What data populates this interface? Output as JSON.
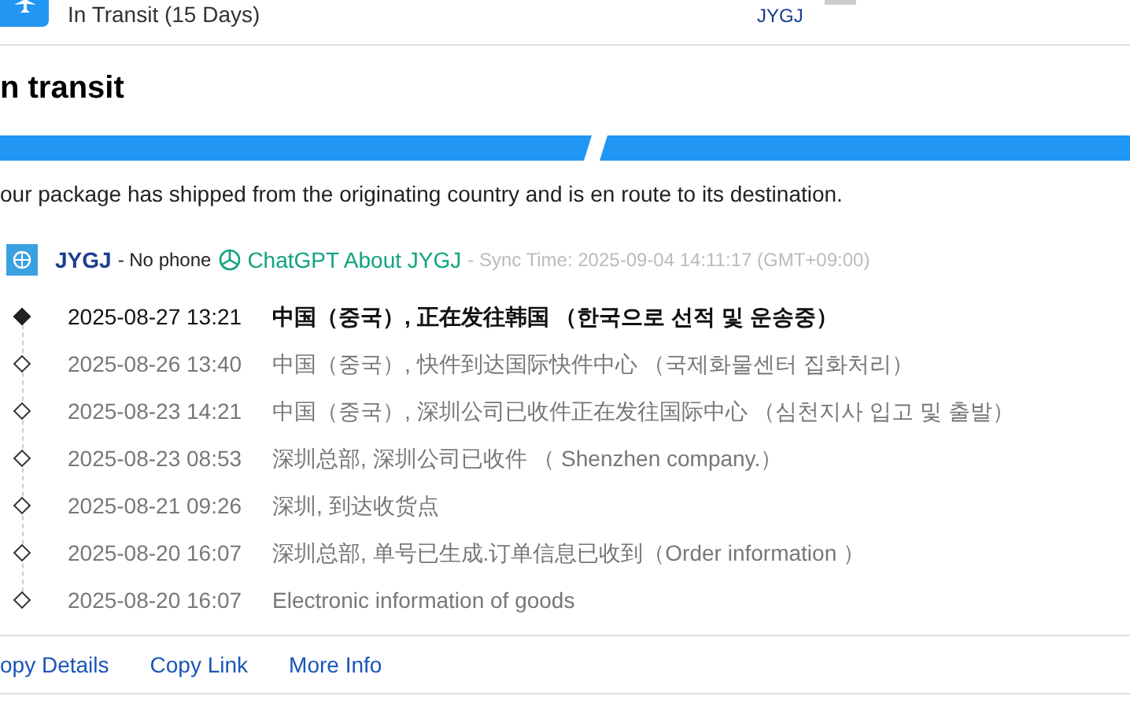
{
  "header": {
    "status": "In Transit (15 Days)",
    "carrier": "JYGJ"
  },
  "title": "n transit",
  "progress": [
    {
      "done": true
    },
    {
      "done": true
    }
  ],
  "description": "our package has shipped from the originating country and is en route to its destination.",
  "carrier_line": {
    "name": "JYGJ",
    "phone": "- No phone",
    "chatgpt_link": "ChatGPT About JYGJ",
    "sync_time": "- Sync Time: 2025-09-04 14:11:17 (GMT+09:00)"
  },
  "events": [
    {
      "time": "2025-08-27 13:21",
      "text": "中国（중국）, 正在发往韩国 （한국으로 선적 및 운송중）",
      "latest": true
    },
    {
      "time": "2025-08-26 13:40",
      "text": "中国（중국）, 快件到达国际快件中心 （국제화물센터 집화처리）",
      "latest": false
    },
    {
      "time": "2025-08-23 14:21",
      "text": "中国（중국）, 深圳公司已收件正在发往国际中心 （심천지사 입고 및 출발）",
      "latest": false
    },
    {
      "time": "2025-08-23 08:53",
      "text": "深圳总部, 深圳公司已收件 （ Shenzhen company.）",
      "latest": false
    },
    {
      "time": "2025-08-21 09:26",
      "text": "深圳, 到达收货点",
      "latest": false
    },
    {
      "time": "2025-08-20 16:07",
      "text": "深圳总部, 单号已生成.订单信息已收到（Order information ）",
      "latest": false
    },
    {
      "time": "2025-08-20 16:07",
      "text": "Electronic information of goods",
      "latest": false
    }
  ],
  "actions": [
    "opy Details",
    "Copy Link",
    "More Info"
  ]
}
